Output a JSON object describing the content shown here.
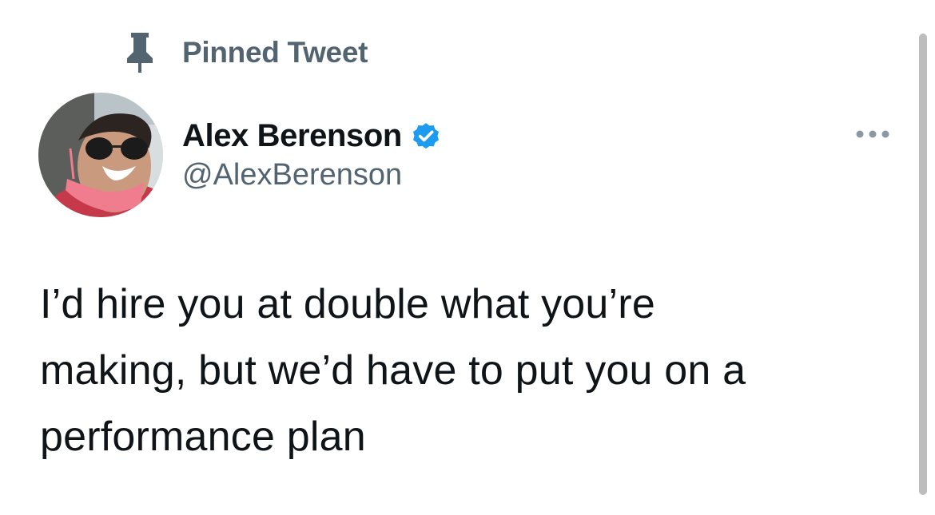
{
  "pinned": {
    "label": "Pinned Tweet",
    "icon": "pin-icon"
  },
  "author": {
    "display_name": "Alex Berenson",
    "handle": "@AlexBerenson",
    "verified": true,
    "verified_icon": "verified-badge-icon",
    "avatar": "profile-photo"
  },
  "menu": {
    "icon": "more-options-icon"
  },
  "tweet": {
    "text": "I’d hire you at double what you’re\nmaking, but we’d have to put you on a\nperformance plan"
  },
  "colors": {
    "text_primary": "#0f1419",
    "text_secondary": "#536471",
    "verified_blue": "#1d9bf0",
    "scrollbar": "#bdbdbd"
  }
}
